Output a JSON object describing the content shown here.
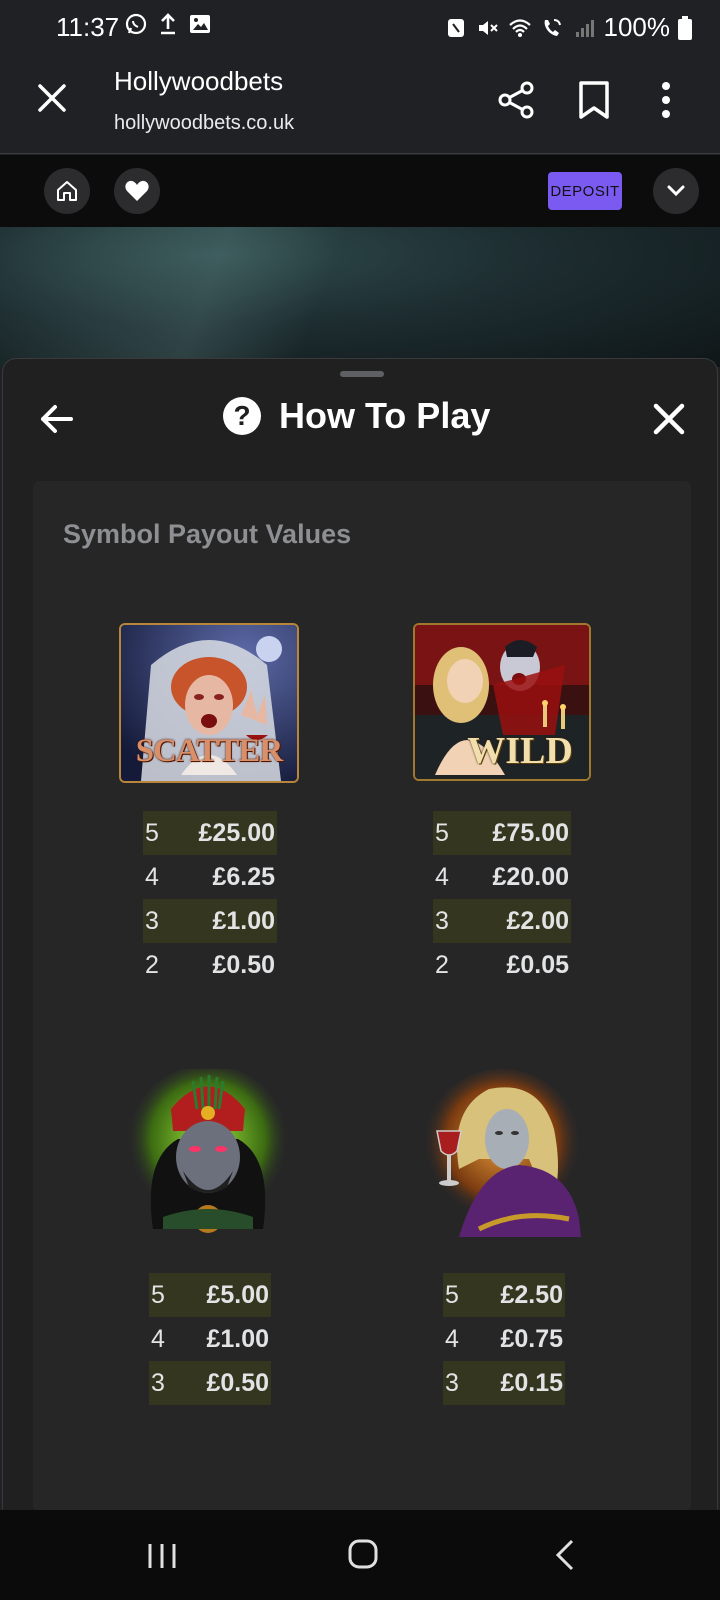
{
  "status_bar": {
    "time": "11:37",
    "battery": "100%",
    "icons": [
      "whatsapp-icon",
      "upload-icon",
      "gallery-icon",
      "mute-icon",
      "wifi-icon",
      "wifi-call-icon",
      "signal-icon",
      "battery-icon"
    ]
  },
  "browser": {
    "title": "Hollywoodbets",
    "url": "hollywoodbets.co.uk"
  },
  "site_bar": {
    "deposit_label": "DEPOSIT",
    "accent": "#7b5af2"
  },
  "sheet": {
    "title": "How To Play",
    "section_header": "Symbol Payout Values"
  },
  "symbols": [
    {
      "name": "scatter",
      "label": "SCATTER",
      "payouts": [
        {
          "count": "5",
          "amount": "£25.00"
        },
        {
          "count": "4",
          "amount": "£6.25"
        },
        {
          "count": "3",
          "amount": "£1.00"
        },
        {
          "count": "2",
          "amount": "£0.50"
        }
      ]
    },
    {
      "name": "wild",
      "label": "WILD",
      "payouts": [
        {
          "count": "5",
          "amount": "£75.00"
        },
        {
          "count": "4",
          "amount": "£20.00"
        },
        {
          "count": "3",
          "amount": "£2.00"
        },
        {
          "count": "2",
          "amount": "£0.05"
        }
      ]
    },
    {
      "name": "red-hat-vampire",
      "payouts": [
        {
          "count": "5",
          "amount": "£5.00"
        },
        {
          "count": "4",
          "amount": "£1.00"
        },
        {
          "count": "3",
          "amount": "£0.50"
        }
      ]
    },
    {
      "name": "blond-vampire",
      "payouts": [
        {
          "count": "5",
          "amount": "£2.50"
        },
        {
          "count": "4",
          "amount": "£0.75"
        },
        {
          "count": "3",
          "amount": "£0.15"
        }
      ]
    }
  ]
}
